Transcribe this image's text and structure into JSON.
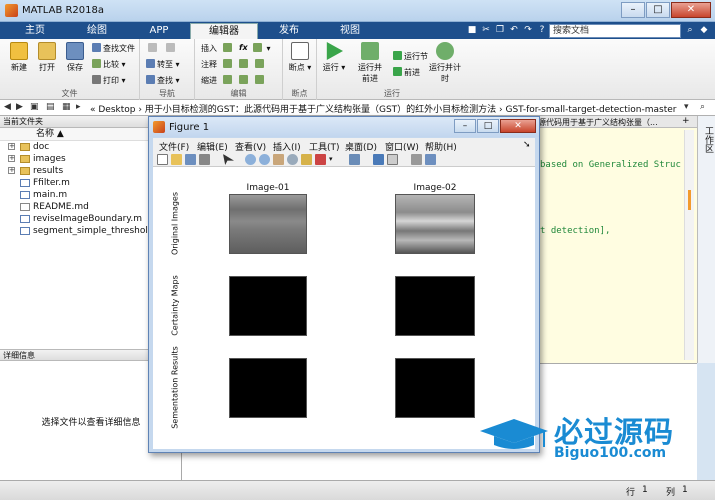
{
  "app": {
    "title": "MATLAB R2018a",
    "window_controls": [
      "–",
      "□",
      "✕"
    ]
  },
  "ribbon_tabs": [
    "主页",
    "绘图",
    "APP",
    "编辑器",
    "发布",
    "视图"
  ],
  "active_tab": "编辑器",
  "search_placeholder": "搜索文档",
  "ribbon": {
    "file_group": {
      "name": "文件",
      "new": "新建",
      "open": "打开",
      "save": "保存",
      "find_files": "查找文件",
      "compare": "比较",
      "print": "打印"
    },
    "nav_group": {
      "name": "导航",
      "goto": "转至",
      "find": "查找"
    },
    "edit_group": {
      "name": "编辑",
      "insert": "插入",
      "comment": "注释",
      "indent": "缩进",
      "fx": "fx"
    },
    "breakpoint_group": {
      "name": "断点",
      "breakpoints": "断点"
    },
    "run_group": {
      "name": "运行",
      "run": "运行",
      "run_advance": "运行并前进",
      "run_section": "运行节",
      "advance": "前进",
      "run_time": "运行并计时"
    }
  },
  "address": {
    "path": "« Desktop › 用于小目标检测的GST：此源代码用于基于广义结构张量（GST）的红外小目标检测方法 › GST-for-small-target-detection-master"
  },
  "current_folder": {
    "title": "当前文件夹",
    "column": "名称 ▲",
    "items": [
      {
        "name": "doc",
        "type": "folder"
      },
      {
        "name": "images",
        "type": "folder"
      },
      {
        "name": "results",
        "type": "folder"
      },
      {
        "name": "Ffilter.m",
        "type": "m"
      },
      {
        "name": "main.m",
        "type": "m"
      },
      {
        "name": "README.md",
        "type": "md"
      },
      {
        "name": "reviseImageBoundary.m",
        "type": "m"
      },
      {
        "name": "segment_simple_threshold.m",
        "type": "m"
      }
    ]
  },
  "details": {
    "title": "详细信息",
    "message": "选择文件以查看详细信息"
  },
  "editor": {
    "tab_title": "源代码用于基于广义结构张量（...",
    "code_line1": "based on  Generalized Struc",
    "code_line2": "t detection],"
  },
  "side_panel": {
    "label": "工作区"
  },
  "status": {
    "row_label": "行",
    "row": "1",
    "col_label": "列",
    "col": "1"
  },
  "figure": {
    "title": "Figure 1",
    "menu": [
      "文件(F)",
      "编辑(E)",
      "查看(V)",
      "插入(I)",
      "工具(T)",
      "桌面(D)",
      "窗口(W)",
      "帮助(H)"
    ],
    "row_labels": [
      "Original Images",
      "Certainty Maps",
      "Sementation Results"
    ],
    "col_titles": [
      "Image-01",
      "Image-02"
    ]
  },
  "watermark": {
    "text": "必过源码",
    "url": "Biguo100.com"
  }
}
